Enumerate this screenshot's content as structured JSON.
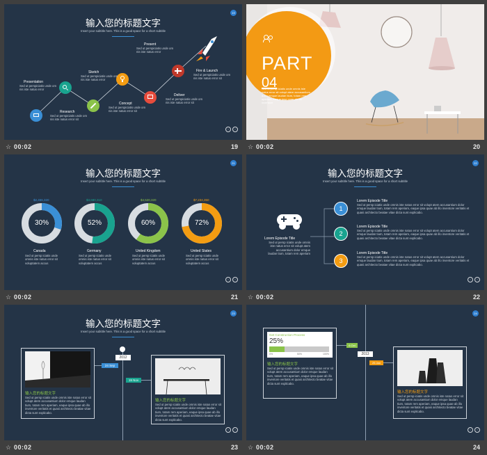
{
  "common": {
    "title": "输入您的标题文字",
    "subtitle": "Insert your subtitle here. This is a good space for a short subtitle",
    "time": "00:02",
    "body_short": "Sed ut persp iciatis unde omnis iste natus error sit vol",
    "body_long": "Sed ut persp iciatis unde omnis iste natus error sit volupt atem accusantium dolor emque laudan tium, totam rem aperiam, eaque ipsa quae ab illo inventore veritatis et quasi architecto beatae vitae dicta sunt explicabo."
  },
  "slides": [
    {
      "id": "s19",
      "number": "19",
      "badge": "19",
      "items": [
        {
          "label": "Presentation",
          "icon": "presentation-icon",
          "color": "#3a8fd6",
          "text": "Sed ut perspiciatis unde om nis iste natus error"
        },
        {
          "label": "Research",
          "icon": "search-icon",
          "color": "#19a38f",
          "text": "Sed ut perspiciatis unde om nis iste natus error sit"
        },
        {
          "label": "Sketch",
          "icon": "pencil-icon",
          "color": "#8bc34a",
          "text": "Sed ut perspiciatis unde om nis iste natus error"
        },
        {
          "label": "Concept",
          "icon": "lightbulb-icon",
          "color": "#f39c12",
          "text": "Sed ut perspiciatis unde om nis iste natus error sit"
        },
        {
          "label": "Present",
          "icon": "presentation-icon",
          "color": "#e74c3c",
          "text": "Sed ut perspiciatis unde om nis iste natus error"
        },
        {
          "label": "Deliver",
          "icon": "plane-icon",
          "color": "#c0392b",
          "text": "Sed ut perspiciatis unde om nis iste natus error sit"
        },
        {
          "label": "Fire & Launch",
          "icon": "rocket-icon",
          "color": "#3a8fd6",
          "text": "Sed ut perspiciatis unde om nis iste natus error sit"
        }
      ]
    },
    {
      "id": "s20",
      "number": "20",
      "part_label": "PART",
      "part_number": "04",
      "part_text": "Sed ut persp iciatis unde omnis iste natus error sit volupt atem accusantium dolor emque laudan tium, totam rem aperiam, eaque ipsa quae ab illo inventore",
      "accent": "#f39a14"
    },
    {
      "id": "s21",
      "number": "21",
      "badge": "21",
      "donuts": [
        {
          "amount": "$2,456,320",
          "percent": "30%",
          "country": "Canada",
          "color": "#3a8fd6"
        },
        {
          "amount": "$3,680,310",
          "percent": "52%",
          "country": "Germany",
          "color": "#19a38f"
        },
        {
          "amount": "$4,520,320",
          "percent": "60%",
          "country": "United Kingdom",
          "color": "#8bc34a"
        },
        {
          "amount": "$7,234,350",
          "percent": "72%",
          "country": "United States",
          "color": "#f39c12"
        }
      ],
      "donut_text": "Sed ut persp iciatis unde omnis iste natus error sit voluptatem accus"
    },
    {
      "id": "s22",
      "number": "22",
      "badge": "22",
      "main_label": "Lorem Episode Title",
      "main_text": "Sed ut persp iciatis unde omnis iste natus error sit volupt atem accusantium dolor emque laudan tium, totam rem aperiam",
      "steps": [
        {
          "n": "1",
          "color": "#3a8fd6",
          "title": "Lorem Episode Title"
        },
        {
          "n": "2",
          "color": "#19a38f",
          "title": "Lorem Episode Title"
        },
        {
          "n": "3",
          "color": "#f39c12",
          "title": "Lorem Episode Title"
        }
      ]
    },
    {
      "id": "s23",
      "number": "23",
      "badge": "23",
      "year": "2012",
      "date1": "24 Sep",
      "date2": "19 Nov",
      "card_title": "输入您的标题文字"
    },
    {
      "id": "s24",
      "number": "24",
      "badge": "24",
      "progress_title": "Get Construction Process",
      "progress_value": 25,
      "progress_label": "25%",
      "scale": [
        "0%",
        "50%",
        "100%"
      ],
      "year": "2013",
      "date1": "6 Oct",
      "date2": "25 Jan",
      "card_title": "输入您的标题文字"
    }
  ]
}
